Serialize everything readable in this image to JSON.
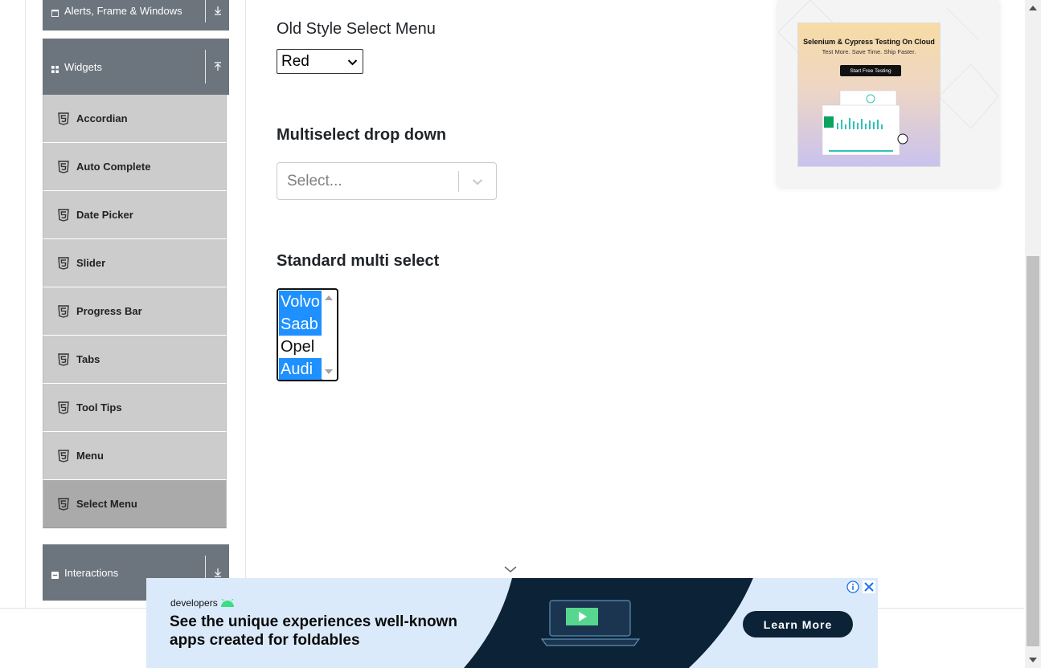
{
  "sidebar": {
    "group_alerts": "Alerts, Frame & Windows",
    "group_widgets": "Widgets",
    "group_interactions": "Interactions",
    "items": [
      {
        "label": "Accordian"
      },
      {
        "label": "Auto Complete"
      },
      {
        "label": "Date Picker"
      },
      {
        "label": "Slider"
      },
      {
        "label": "Progress Bar"
      },
      {
        "label": "Tabs"
      },
      {
        "label": "Tool Tips"
      },
      {
        "label": "Menu"
      },
      {
        "label": "Select Menu"
      }
    ],
    "active_item": "Select Menu"
  },
  "main": {
    "old_style_label": "Old Style Select Menu",
    "old_style_value": "Red",
    "multiselect_heading": "Multiselect drop down",
    "multiselect_placeholder": "Select...",
    "standard_heading": "Standard multi select",
    "standard_options": [
      {
        "label": "Volvo",
        "selected": true
      },
      {
        "label": "Saab",
        "selected": true
      },
      {
        "label": "Opel",
        "selected": false
      },
      {
        "label": "Audi",
        "selected": true
      }
    ]
  },
  "right_ad": {
    "title": "Selenium & Cypress Testing On Cloud",
    "subtitle": "Test More. Save Time. Ship Faster.",
    "button": "Start Free Testing"
  },
  "bottom_ad": {
    "brand": "developers",
    "headline": "See the unique experiences well-known apps created for foldables",
    "cta": "Learn More"
  },
  "colors": {
    "sidebar_header": "#6c757d",
    "menu_item": "#cccccc",
    "menu_item_active": "#aaaaaa",
    "option_selected": "#1e90ff",
    "ad_dark": "#0c2236",
    "ad_light": "#dbeafb",
    "android_green": "#3ddc84"
  }
}
